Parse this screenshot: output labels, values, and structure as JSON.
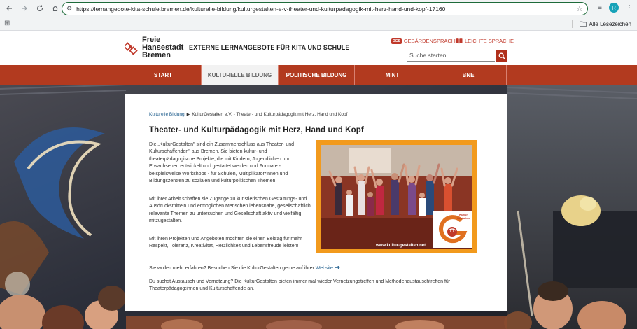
{
  "browser": {
    "url": "https://lernangebote-kita-schule.bremen.de/kulturelle-bildung/kulturgestalten-e-v-theater-und-kulturpadagogik-mit-herz-hand-und-kopf-17160",
    "profile_initial": "R",
    "bookmarks_label": "Alle Lesezeichen"
  },
  "site": {
    "logo_lines": [
      "Freie",
      "Hansestadt",
      "Bremen"
    ],
    "title": "EXTERNE LERNANGEBOTE FÜR KITA UND SCHULE",
    "gebaerden_badge": "DGS",
    "gebaerden_label": "GEBÄRDENSPRACHE",
    "leichte_label": "LEICHTE SPRACHE",
    "search_placeholder": "Suche starten",
    "brand_color": "#b23a1f"
  },
  "nav": {
    "items": [
      {
        "label": "START",
        "active": false
      },
      {
        "label": "KULTURELLE BILDUNG",
        "active": true
      },
      {
        "label": "POLITISCHE BILDUNG",
        "active": false
      },
      {
        "label": "MINT",
        "active": false
      },
      {
        "label": "BNE",
        "active": false
      }
    ]
  },
  "content": {
    "breadcrumb": {
      "parent": "Kulturelle Bildung",
      "current": "KulturGestalten e.V. - Theater- und Kulturpädagogik mit Herz, Hand und Kopf"
    },
    "title": "Theater- und Kulturpädagogik mit Herz, Hand und Kopf",
    "paragraphs": [
      "Die „KulturGestalten\" sind ein Zusammenschluss aus Theater- und Kulturschaffenden\" aus Bremen. Sie bieten kultur- und theaterpädagogische Projekte, die mit Kindern, Jugendlichen und Erwachsenen entwickelt und gestaltet werden und Formate - beispielsweise Workshops - für Schulen, Multiplikator*innen und Bildungszentren zu sozialen und kulturpolitischen Themen.",
      "Mit ihrer Arbeit schaffen sie Zugänge zu künstlerischen Gestaltungs- und Ausdrucksmitteln und ermöglichen Menschen lebensnahe, gesellschaftlich relevante Themen zu untersuchen und Gesellschaft aktiv und vielfältig mitzugestalten.",
      "Mit ihren Projekten und Angeboten möchten sie einen Beitrag für mehr Respekt, Toleranz, Kreativität, Herzlichkeit und Lebensfreude leisten!"
    ],
    "more_info_text": "Sie wollen mehr erfahren? Besuchen Sie die KulturGestalten gerne auf ihrer",
    "website_link": "Website",
    "network_text": "Du suchst Austausch und Vernetzung? Die KulturGestalten bieten immer mal wieder Vernetzungstreffen und Methodenaustauschtreffen für Theaterpädagog:innen und Kulturschaffende an.",
    "photo_url_text": "www.kultur-gestalten.net",
    "photo_logo_text": "Kultur Gestalten"
  }
}
